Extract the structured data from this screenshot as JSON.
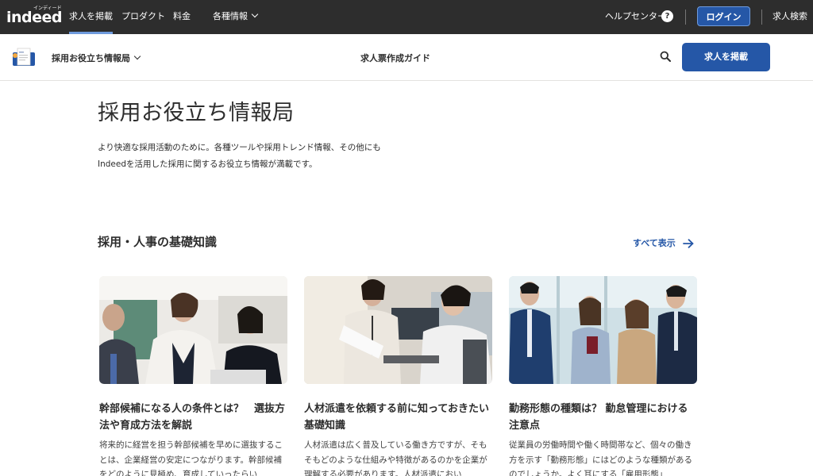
{
  "topbar": {
    "logo": "indeed",
    "logo_sub": "インディード",
    "nav": [
      {
        "label": "求人を掲載"
      },
      {
        "label": "プロダクト"
      },
      {
        "label": "料金"
      },
      {
        "label": "各種情報"
      }
    ],
    "help_label": "ヘルプセンター",
    "help_icon_glyph": "?",
    "login_label": "ログイン",
    "job_search_label": "求人検索"
  },
  "subbar": {
    "title": "採用お役立ち情報局",
    "guide_link": "求人票作成ガイド",
    "post_button": "求人を掲載"
  },
  "hero": {
    "title": "採用お役立ち情報局",
    "intro_line1": "より快適な採用活動のために。各種ツールや採用トレンド情報、その他にも",
    "intro_line2": "Indeedを活用した採用に関するお役立ち情報が満載です。"
  },
  "section": {
    "title": "採用・人事の基礎知識",
    "see_all": "すべて表示"
  },
  "cards": [
    {
      "title": "幹部候補になる人の条件とは？　選抜方法や育成方法を解説",
      "desc": "将来的に経営を担う幹部候補を早めに選抜することは、企業経営の安定につながります。幹部候補をどのように見極め、育成していったらい"
    },
    {
      "title": "人材派遣を依頼する前に知っておきたい基礎知識",
      "desc": "人材派遣は広く普及している働き方ですが、そもそもどのような仕組みや特徴があるのかを企業が理解する必要があります。人材派遣におい"
    },
    {
      "title": "勤務形態の種類は？ 勤怠管理における注意点",
      "desc": "従業員の労働時間や働く時間帯など、個々の働き方を示す「勤務形態」にはどのような種類があるのでしょうか。よく耳にする「雇用形態」"
    }
  ],
  "colors": {
    "topbar_bg": "#2d2d2d",
    "brand_blue": "#2557a7",
    "active_underline": "#6f9bdd"
  }
}
